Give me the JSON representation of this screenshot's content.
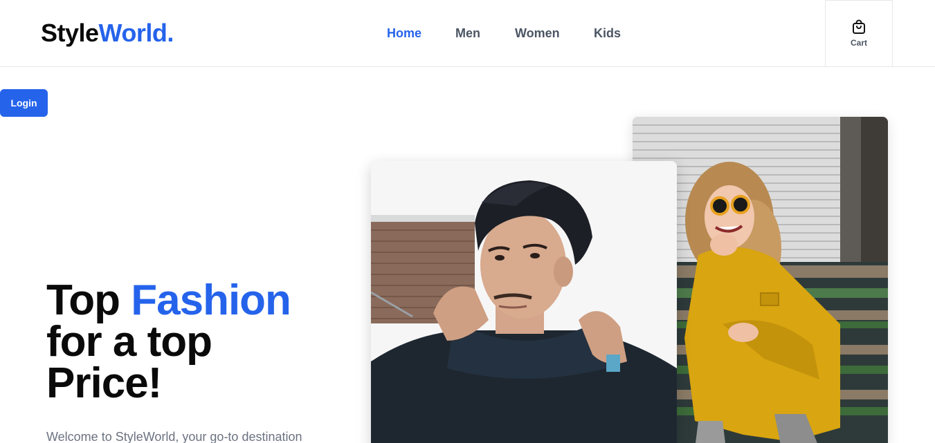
{
  "brand": {
    "part1": "Style",
    "part2": "World."
  },
  "nav": {
    "items": [
      {
        "label": "Home",
        "active": true
      },
      {
        "label": "Men",
        "active": false
      },
      {
        "label": "Women",
        "active": false
      },
      {
        "label": "Kids",
        "active": false
      }
    ]
  },
  "cart": {
    "label": "Cart",
    "icon": "shopping-bag-icon"
  },
  "auth": {
    "login_label": "Login"
  },
  "hero": {
    "title_part1": "Top ",
    "title_highlight": "Fashion",
    "title_line2": "for a top",
    "title_line3": "Price!",
    "description": "Welcome to StyleWorld, your go-to destination"
  },
  "colors": {
    "accent": "#2563eb",
    "text_dark": "#0a0a0a",
    "text_muted": "#4b5563"
  }
}
